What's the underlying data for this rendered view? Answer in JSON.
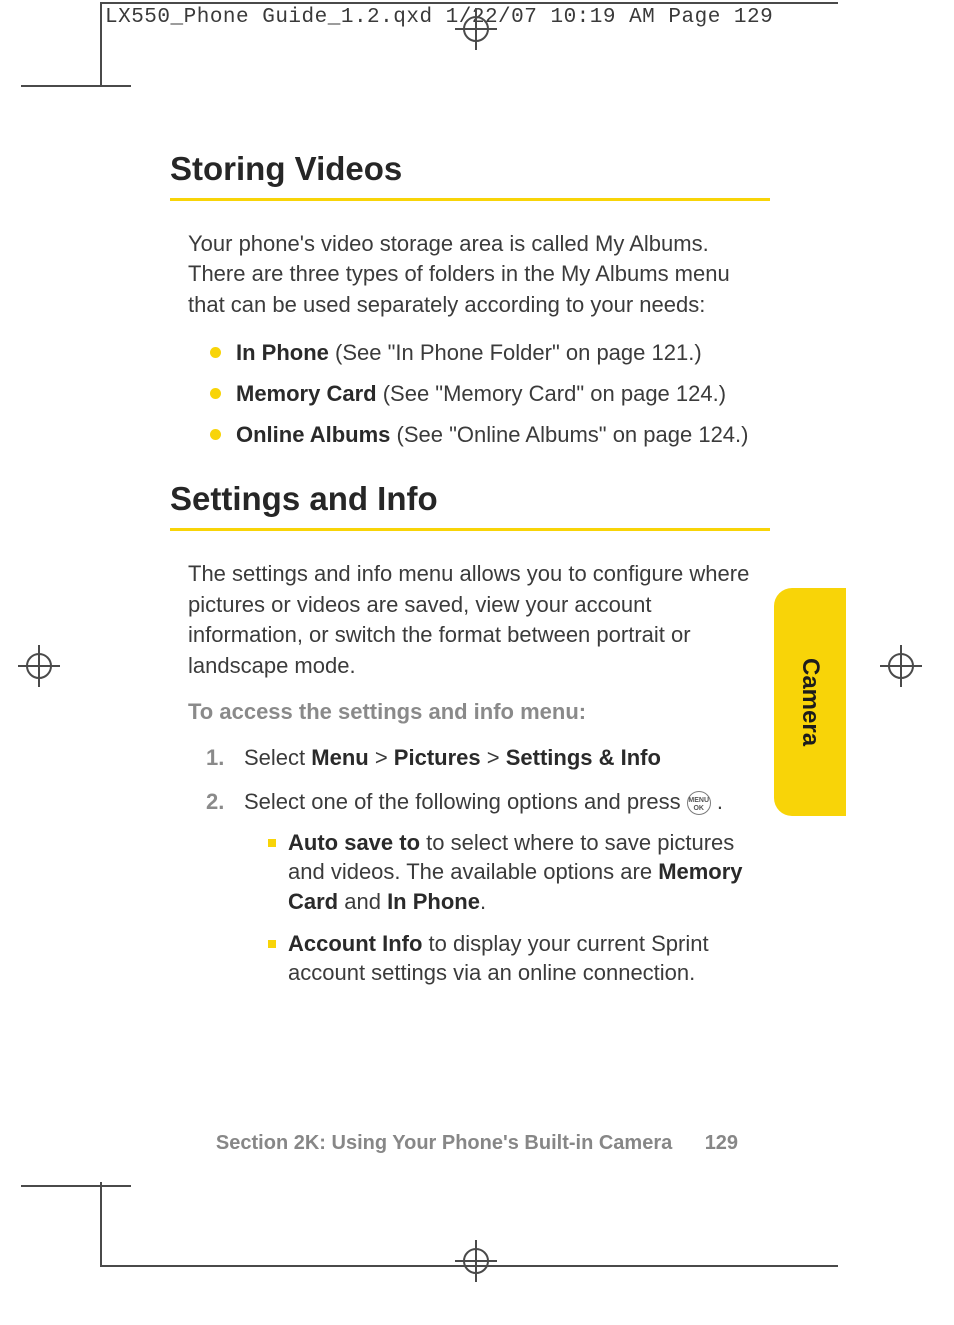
{
  "slug": "LX550_Phone Guide_1.2.qxd  1/22/07  10:19 AM  Page 129",
  "side_tab": "Camera",
  "h1_a": "Storing Videos",
  "intro_a": "Your phone's video storage area is called My Albums. There are three types of folders in the My Albums menu that can be used separately according to your needs:",
  "bullets": {
    "b1_strong": "In Phone",
    "b1_rest": " (See \"In Phone Folder\" on page 121.)",
    "b2_strong": "Memory Card",
    "b2_rest": " (See \"Memory Card\" on page 124.)",
    "b3_strong": "Online Albums",
    "b3_rest": " (See \"Online Albums\" on page 124.)"
  },
  "h1_b": "Settings and Info",
  "intro_b": "The settings and info menu allows you to configure where pictures or videos are saved, view your account information, or switch the format between portrait or landscape mode.",
  "lead_b": "To access the settings and info menu:",
  "steps": {
    "s1_num": "1.",
    "s1_pre": "Select ",
    "s1_b1": "Menu",
    "s1_sep1": " > ",
    "s1_b2": "Pictures",
    "s1_sep2": " > ",
    "s1_b3": "Settings & Info",
    "s2_num": "2.",
    "s2_pre": "Select one of the following options and press ",
    "s2_icon_top": "MENU",
    "s2_icon_bot": "OK",
    "s2_post": " ."
  },
  "sub": {
    "a_b": "Auto save to",
    "a_mid1": " to select where to save pictures and videos. The available options are  ",
    "a_b2": "Memory Card",
    "a_mid2": " and ",
    "a_b3": "In Phone",
    "a_end": ".",
    "b_b": "Account Info",
    "b_rest": " to display your current Sprint account settings via an online connection."
  },
  "footer": {
    "section": "Section 2K: Using Your Phone's Built-in Camera",
    "page": "129"
  }
}
